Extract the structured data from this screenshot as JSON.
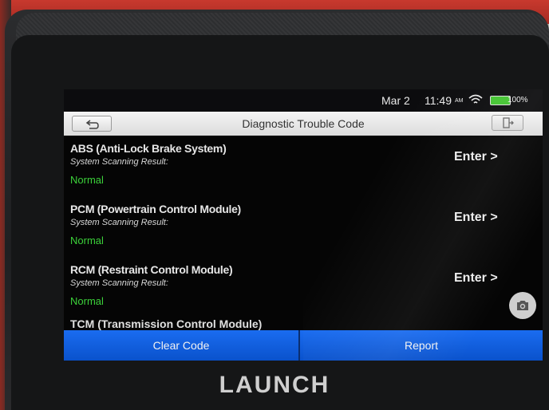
{
  "status_bar": {
    "date": "Mar 2",
    "time": "11:49",
    "ampm": "AM",
    "battery": "100%"
  },
  "title_bar": {
    "title": "Diagnostic Trouble Code"
  },
  "systems": [
    {
      "name": "ABS (Anti-Lock Brake System)",
      "label": "System Scanning Result:",
      "status": "Normal",
      "action": "Enter >"
    },
    {
      "name": "PCM (Powertrain Control Module)",
      "label": "System Scanning Result:",
      "status": "Normal",
      "action": "Enter >"
    },
    {
      "name": "RCM (Restraint Control Module)",
      "label": "System Scanning Result:",
      "status": "Normal",
      "action": "Enter >"
    },
    {
      "name": "TCM (Transmission Control Module)"
    }
  ],
  "bottom_bar": {
    "clear_label": "Clear Code",
    "report_label": "Report"
  },
  "brand": "LAUNCH",
  "colors": {
    "accent_blue": "#0a5ad8",
    "status_green": "#3cd13a"
  },
  "icons": {
    "back": "back-arrow-icon",
    "exit": "exit-door-icon",
    "camera": "camera-icon",
    "wifi": "wifi-icon",
    "battery": "battery-icon"
  }
}
